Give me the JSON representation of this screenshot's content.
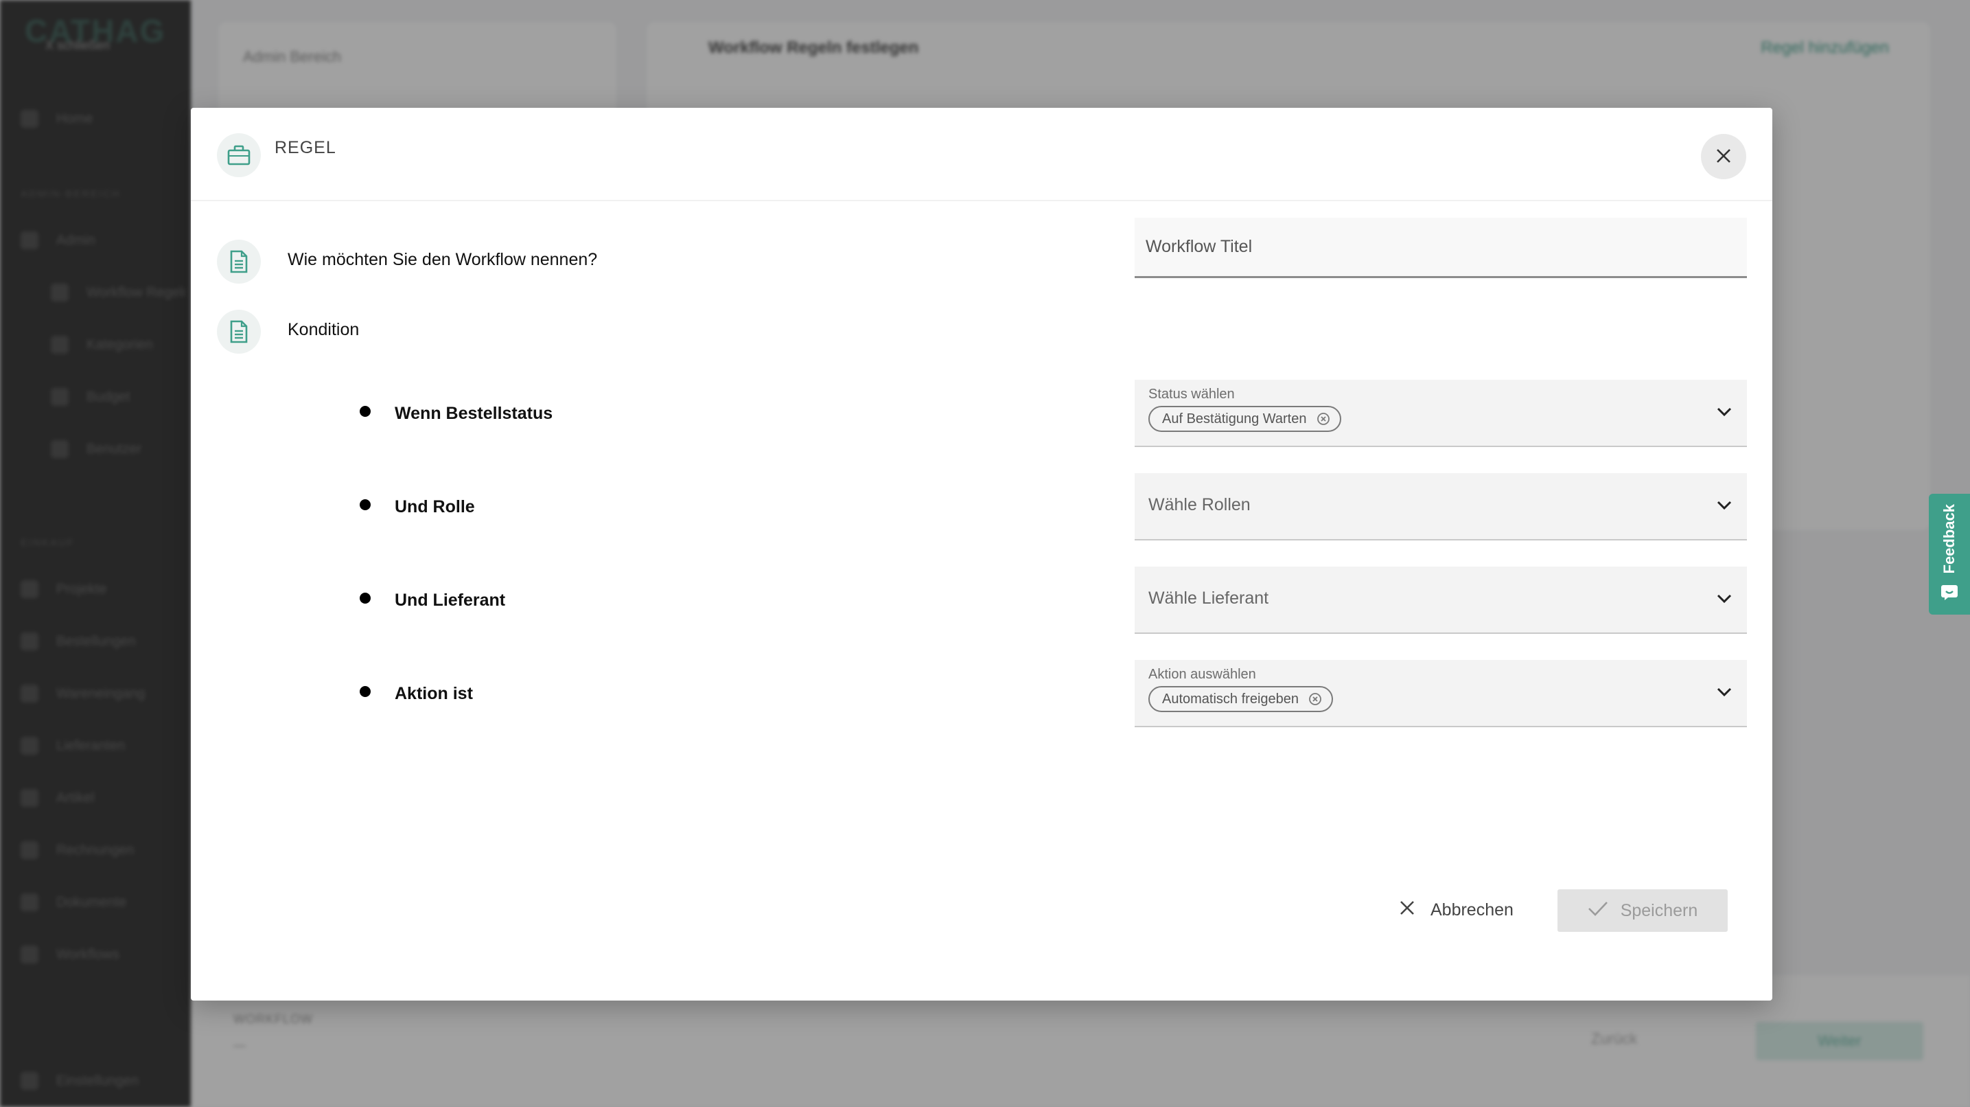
{
  "background": {
    "logo": "CATHAG",
    "logo_sub": "X schließen",
    "nav_top": [
      "Home"
    ],
    "section_1": "ADMIN-BEREICH",
    "nav_items_1": [
      "Admin",
      "Workflow Regeln",
      "Kategorien",
      "Budget",
      "Benutzer"
    ],
    "section_2": "EINKAUF",
    "nav_items_2": [
      "Projekte",
      "Bestellungen",
      "Wareneingang",
      "Lieferanten",
      "Artikel",
      "Rechnungen",
      "Dokumente",
      "Workflows"
    ],
    "footer_nav": "Einstellungen",
    "left_card_title": "Admin Bereich",
    "main_card_title": "Workflow Regeln festlegen",
    "main_card_add": "Regel hinzufügen",
    "bottom_label": "WORKFLOW",
    "bottom_value": "—",
    "back_label": "Zurück",
    "next_label": "Weiter"
  },
  "feedback": {
    "label": "Feedback"
  },
  "modal": {
    "title": "REGEL",
    "question_name": "Wie möchten Sie den Workflow nennen?",
    "title_placeholder": "Workflow Titel",
    "condition_label": "Kondition",
    "rows": [
      {
        "label": "Wenn Bestellstatus",
        "field_label": "Status wählen",
        "chip": "Auf Bestätigung Warten",
        "placeholder": ""
      },
      {
        "label": "Und Rolle",
        "field_label": "",
        "chip": "",
        "placeholder": "Wähle Rollen"
      },
      {
        "label": "Und Lieferant",
        "field_label": "",
        "chip": "",
        "placeholder": "Wähle Lieferant"
      },
      {
        "label": "Aktion ist",
        "field_label": "Aktion auswählen",
        "chip": "Automatisch freigeben",
        "placeholder": ""
      }
    ],
    "cancel_label": "Abbrechen",
    "save_label": "Speichern"
  },
  "colors": {
    "accent": "#3f9f8a",
    "icon_bg": "#eef2f1",
    "field_bg": "#f3f3f3",
    "disabled_bg": "#e2e2e2",
    "overlay": "rgba(30,30,30,0.42)"
  },
  "icons": {
    "header": "briefcase-icon",
    "question": "document-icon",
    "close": "close-icon",
    "dropdown": "chevron-down-icon",
    "chip_remove": "remove-chip-icon",
    "cancel": "x-icon",
    "save": "check-icon",
    "feedback": "chat-icon"
  }
}
